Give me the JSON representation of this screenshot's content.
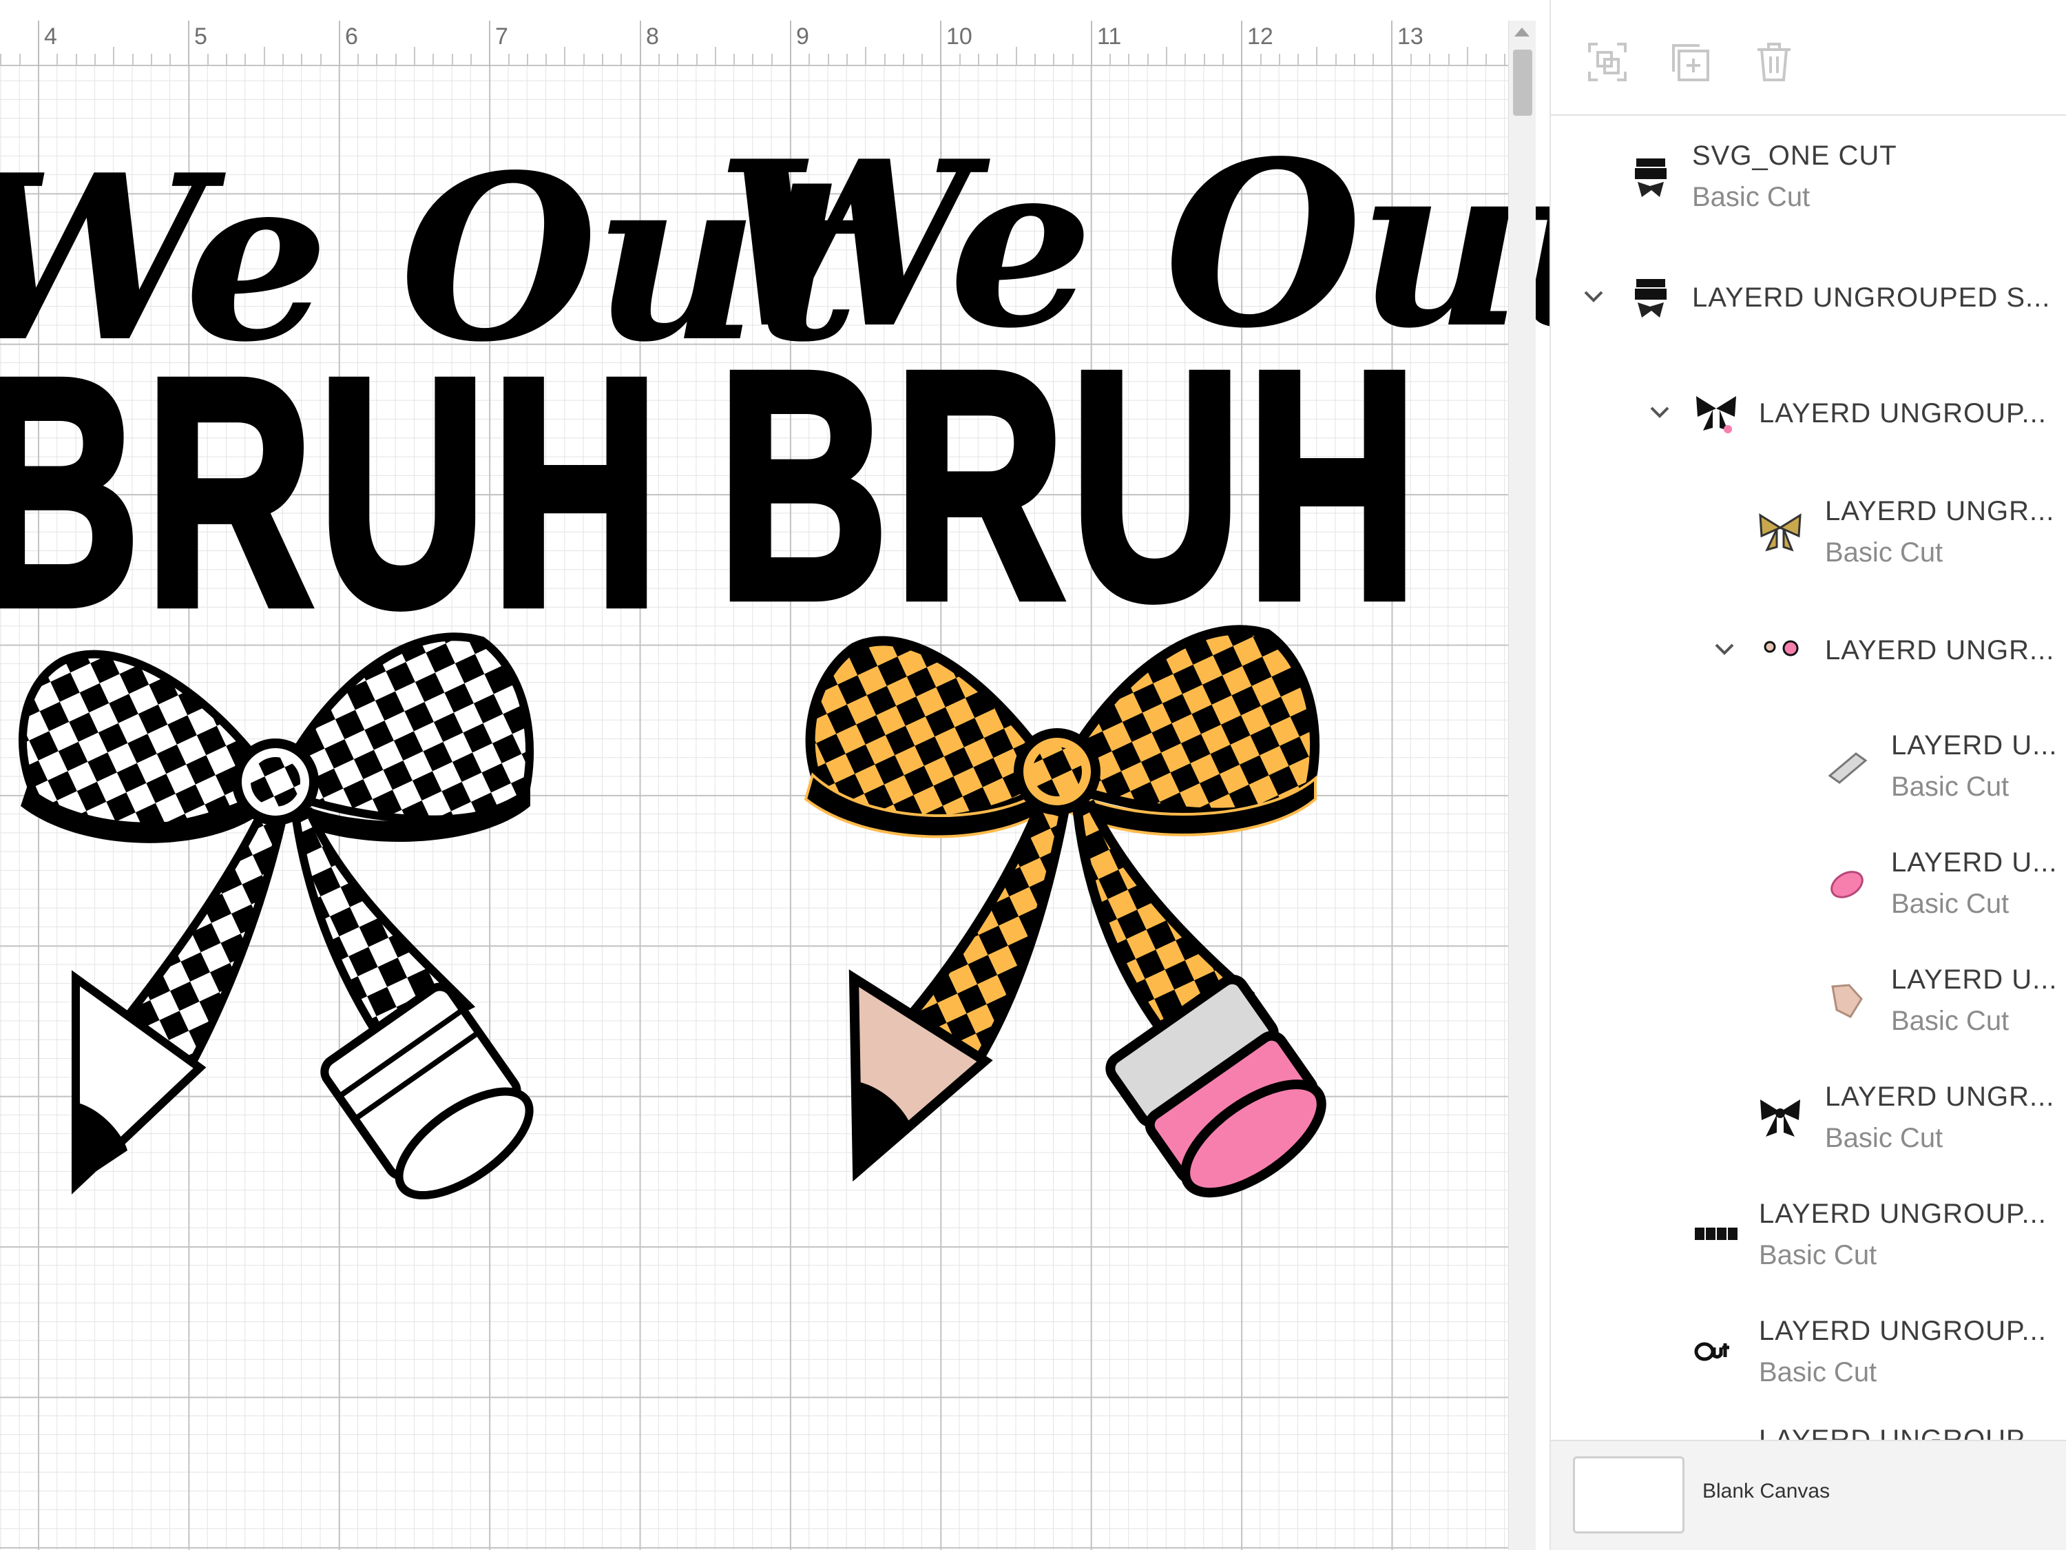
{
  "ruler": {
    "labels": [
      "4",
      "5",
      "6",
      "7",
      "8",
      "9",
      "10",
      "11",
      "12",
      "13"
    ]
  },
  "artwork": {
    "left_design": {
      "script": "We Out",
      "block": "BRUH"
    },
    "right_design": {
      "script": "We Out",
      "block": "BRUH"
    },
    "colors": {
      "ink": "#000000",
      "checker_gold": "#FDBA4B",
      "eraser_pink": "#F77FAE",
      "pencil_wood": "#E8C4B4",
      "ferrule_gray": "#D9D9D9"
    }
  },
  "toolbar": {
    "icons": [
      "group-icon",
      "duplicate-icon",
      "delete-icon"
    ]
  },
  "layers": [
    {
      "name": "SVG_ONE CUT",
      "sub": "Basic Cut",
      "thumb": "we-out-bruh-thumb-icon",
      "expanded": null
    },
    {
      "name": "LAYERD UNGROUPED S...",
      "sub": "",
      "thumb": "we-out-bruh-thumb-icon",
      "expanded": true
    },
    {
      "name": "LAYERD UNGROUP...",
      "sub": "",
      "thumb": "bow-pencil-thumb-icon",
      "expanded": true
    },
    {
      "name": "LAYERD UNGR...",
      "sub": "Basic Cut",
      "thumb": "gold-bow-thumb-icon",
      "expanded": null
    },
    {
      "name": "LAYERD UNGR...",
      "sub": "",
      "thumb": "eraser-parts-thumb-icon",
      "expanded": true
    },
    {
      "name": "LAYERD U...",
      "sub": "Basic Cut",
      "thumb": "gray-band-thumb-icon",
      "expanded": null
    },
    {
      "name": "LAYERD U...",
      "sub": "Basic Cut",
      "thumb": "pink-eraser-thumb-icon",
      "expanded": null
    },
    {
      "name": "LAYERD U...",
      "sub": "Basic Cut",
      "thumb": "pencil-wood-thumb-icon",
      "expanded": null
    },
    {
      "name": "LAYERD UNGR...",
      "sub": "Basic Cut",
      "thumb": "black-bow-thumb-icon",
      "expanded": null
    },
    {
      "name": "LAYERD UNGROUP...",
      "sub": "Basic Cut",
      "thumb": "bruh-text-thumb-icon",
      "expanded": null
    },
    {
      "name": "LAYERD UNGROUP...",
      "sub": "Basic Cut",
      "thumb": "out-text-thumb-icon",
      "expanded": null
    },
    {
      "name": "LAYERD UNGROUP...",
      "sub": "",
      "thumb": "layer-thumb-icon",
      "expanded": null
    }
  ],
  "footer": {
    "label": "Blank Canvas"
  }
}
